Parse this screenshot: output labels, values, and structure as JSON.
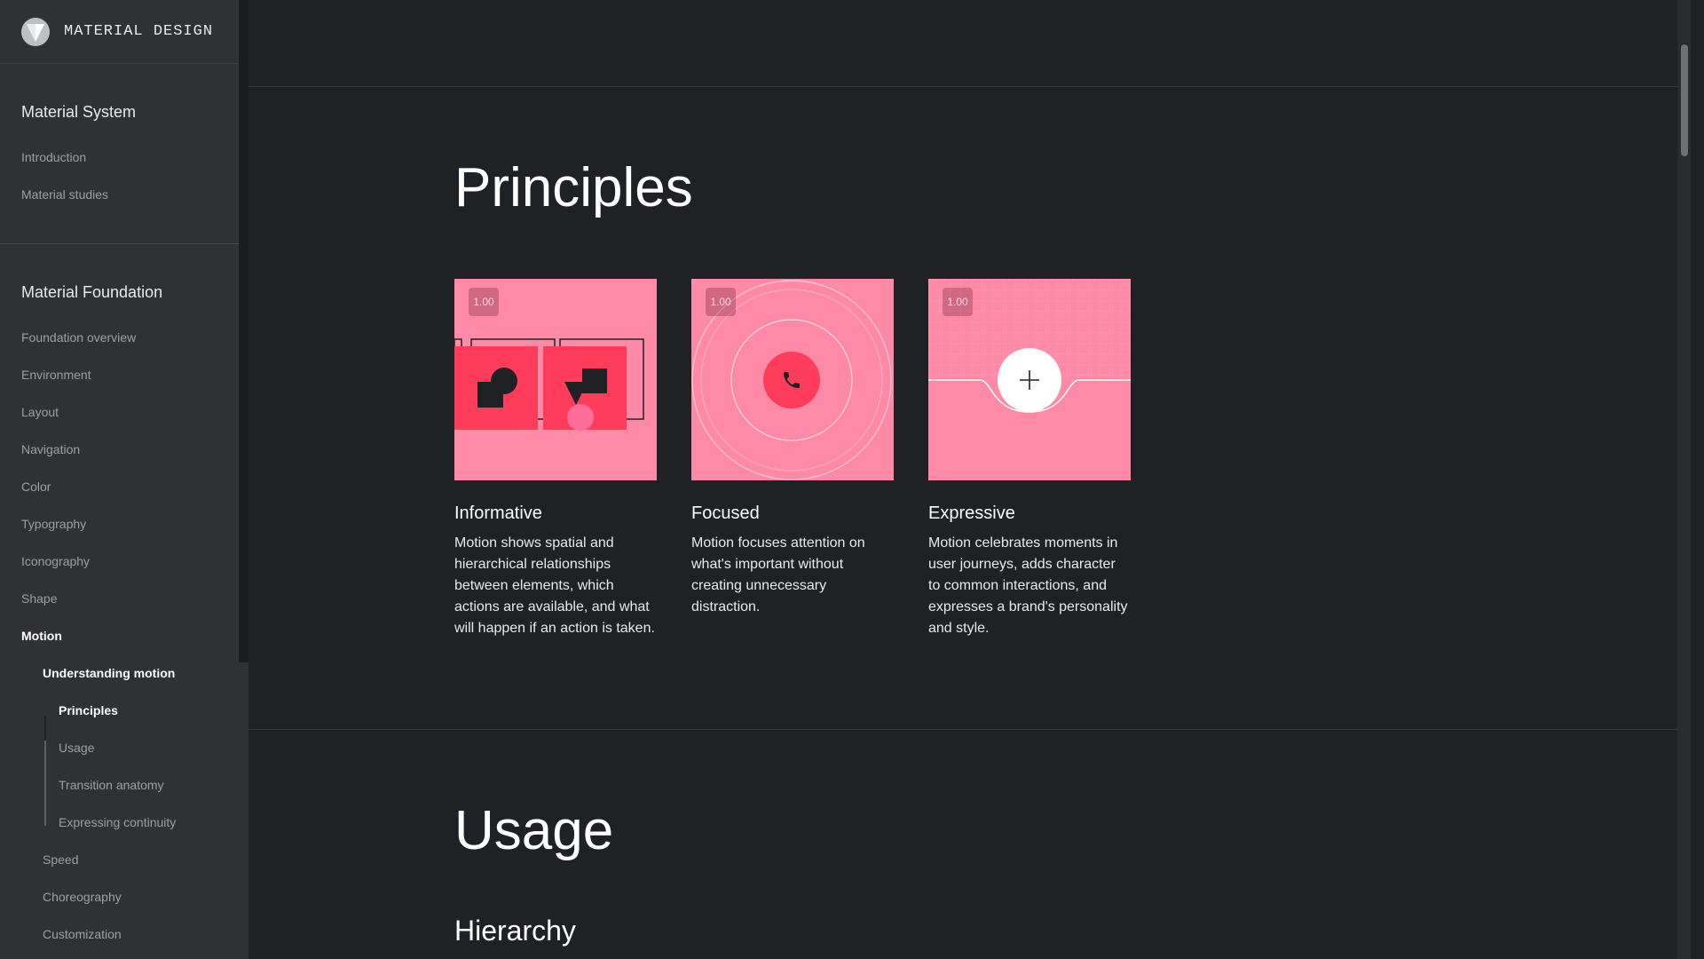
{
  "brand": {
    "name": "MATERIAL DESIGN",
    "logo_icon": "material-logo-icon"
  },
  "sidebar": {
    "system": {
      "heading": "Material System",
      "items": [
        "Introduction",
        "Material studies"
      ]
    },
    "foundation": {
      "heading": "Material Foundation",
      "items": [
        "Foundation overview",
        "Environment",
        "Layout",
        "Navigation",
        "Color",
        "Typography",
        "Iconography",
        "Shape",
        "Motion"
      ],
      "motion_children": {
        "understanding": "Understanding motion",
        "understanding_children": [
          "Principles",
          "Usage",
          "Transition anatomy",
          "Expressing continuity"
        ],
        "others": [
          "Speed",
          "Choreography",
          "Customization"
        ]
      }
    }
  },
  "main": {
    "principles_title": "Principles",
    "cards": [
      {
        "badge": "1.00",
        "title": "Informative",
        "body": "Motion shows spatial and hierarchical relationships between elements, which actions are available, and what will happen if an action is taken.",
        "icon": "informative-illustration"
      },
      {
        "badge": "1.00",
        "title": "Focused",
        "body": "Motion focuses attention on what's important without creating unnecessary distraction.",
        "icon": "phone-icon"
      },
      {
        "badge": "1.00",
        "title": "Expressive",
        "body": "Motion celebrates moments in user journeys, adds character to common interactions, and expresses a brand's personality and style.",
        "icon": "plus-icon"
      }
    ],
    "usage_title": "Usage",
    "hierarchy_title": "Hierarchy"
  },
  "colors": {
    "accent_pink": "#ff8aa8",
    "accent_red": "#ff3d5a",
    "background": "#202124",
    "sidebar": "#303134"
  }
}
